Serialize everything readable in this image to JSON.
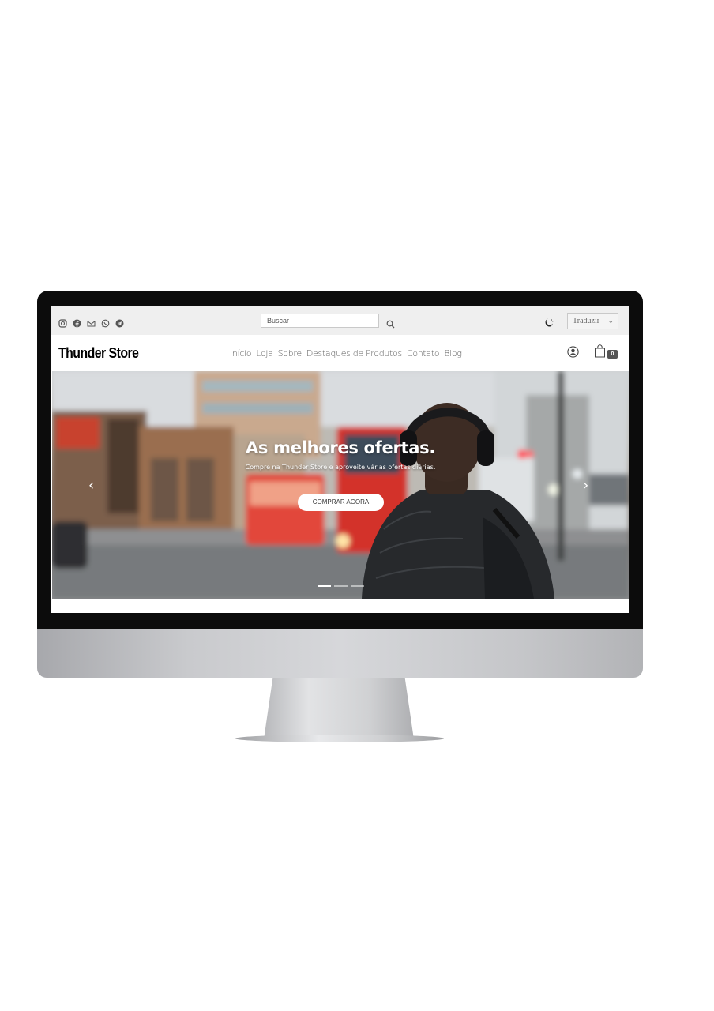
{
  "topbar": {
    "social_icons": [
      "instagram-icon",
      "facebook-icon",
      "email-icon",
      "whatsapp-icon",
      "telegram-icon"
    ],
    "search_placeholder": "Buscar",
    "translate_label": "Traduzir",
    "translate_chevron": "⌄"
  },
  "navbar": {
    "logo": "Thunder Store",
    "menu": [
      "Início",
      "Loja",
      "Sobre",
      "Destaques de Produtos",
      "Contato",
      "Blog"
    ],
    "cart_count": "0"
  },
  "hero": {
    "title": "As melhores ofertas.",
    "subtitle": "Compre na Thunder Store e aproveite várias ofertas diárias.",
    "button_label": "COMPRAR AGORA",
    "arrow_left": "‹",
    "arrow_right": "›",
    "slide_count": 3,
    "active_slide": 1
  },
  "colors": {
    "topbar_bg": "#efefef",
    "cart_badge": "#555555",
    "bezel": "#0c0c0c"
  }
}
